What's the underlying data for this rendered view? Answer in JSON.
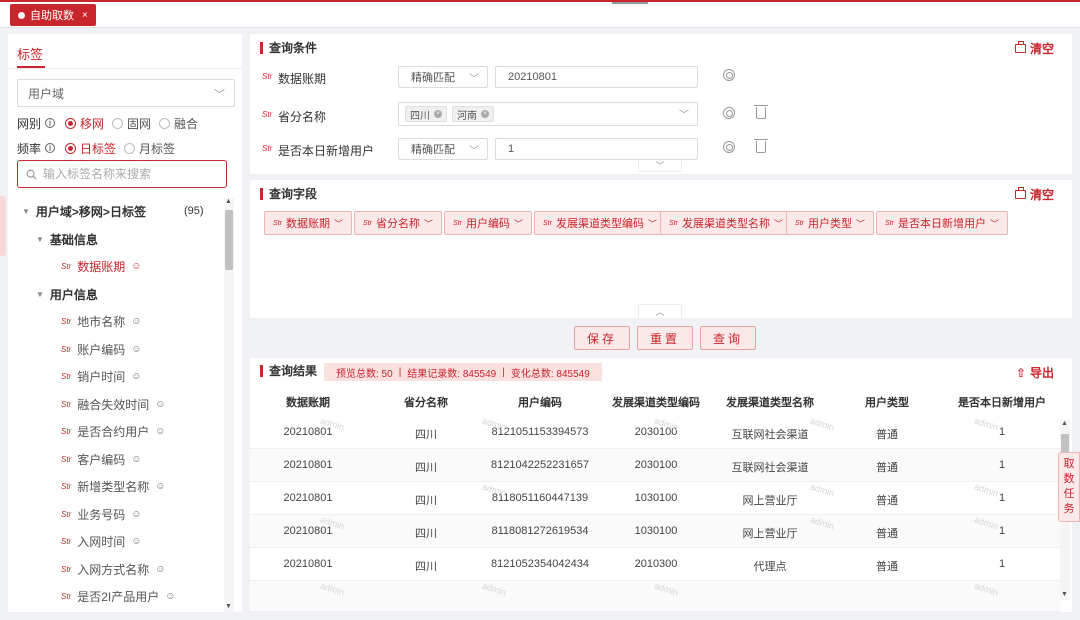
{
  "topbar": {
    "tab_label": "自助取数",
    "tab_close": "×"
  },
  "left": {
    "title": "标签",
    "domain_select": "用户域",
    "network": {
      "label": "网别",
      "options": [
        "移网",
        "固网",
        "融合"
      ],
      "selected": "移网"
    },
    "frequency": {
      "label": "频率",
      "options": [
        "日标签",
        "月标签"
      ],
      "selected": "日标签"
    },
    "search_placeholder": "输入标签名称来搜索",
    "tree": {
      "root_label": "用户域>移网>日标签",
      "root_count": "(95)",
      "group1": "基础信息",
      "group1_items": [
        "数据账期"
      ],
      "group2": "用户信息",
      "group2_items": [
        "地市名称",
        "账户编码",
        "销户时间",
        "融合失效时间",
        "是否合约用户",
        "客户编码",
        "新增类型名称",
        "业务号码",
        "入网时间",
        "入网方式名称",
        "是否2I产品用户"
      ]
    }
  },
  "conditions": {
    "title": "查询条件",
    "clear_label": "清空",
    "rows": [
      {
        "label": "数据账期",
        "match": "精确匹配",
        "value": "20210801"
      },
      {
        "label": "省分名称",
        "chips": [
          "四川",
          "河南"
        ]
      },
      {
        "label": "是否本日新增用户",
        "match": "精确匹配",
        "value": "1"
      }
    ]
  },
  "fields": {
    "title": "查询字段",
    "clear_label": "清空",
    "tags": [
      "数据账期",
      "省分名称",
      "用户编码",
      "发展渠道类型编码",
      "发展渠道类型名称",
      "用户类型",
      "是否本日新增用户"
    ]
  },
  "actions": {
    "save": "保存",
    "reset": "重置",
    "query": "查询"
  },
  "results": {
    "title": "查询结果",
    "stats": {
      "preview": "预览总数: 50",
      "records": "结果记录数: 845549",
      "changes": "变化总数: 845549",
      "sep": "|"
    },
    "export_label": "导出",
    "columns": [
      "数据账期",
      "省分名称",
      "用户编码",
      "发展渠道类型编码",
      "发展渠道类型名称",
      "用户类型",
      "是否本日新增用户"
    ],
    "rows": [
      [
        "20210801",
        "四川",
        "8121051153394573",
        "2030100",
        "互联网社会渠道",
        "普通",
        "1"
      ],
      [
        "20210801",
        "四川",
        "8121042252231657",
        "2030100",
        "互联网社会渠道",
        "普通",
        "1"
      ],
      [
        "20210801",
        "四川",
        "8118051160447139",
        "1030100",
        "网上营业厅",
        "普通",
        "1"
      ],
      [
        "20210801",
        "四川",
        "8118081272619534",
        "1030100",
        "网上营业厅",
        "普通",
        "1"
      ],
      [
        "20210801",
        "四川",
        "8121052354042434",
        "2010300",
        "代理点",
        "普通",
        "1"
      ]
    ],
    "watermark": "admin"
  },
  "side_task": [
    "取",
    "数",
    "任",
    "务"
  ],
  "colors": {
    "accent": "#c9252c",
    "tag_bg": "#fbe9e9"
  },
  "icons": {
    "settings": "gear-icon",
    "delete": "trash-icon",
    "clear": "clear-icon",
    "export": "export-icon",
    "search": "search-icon"
  }
}
